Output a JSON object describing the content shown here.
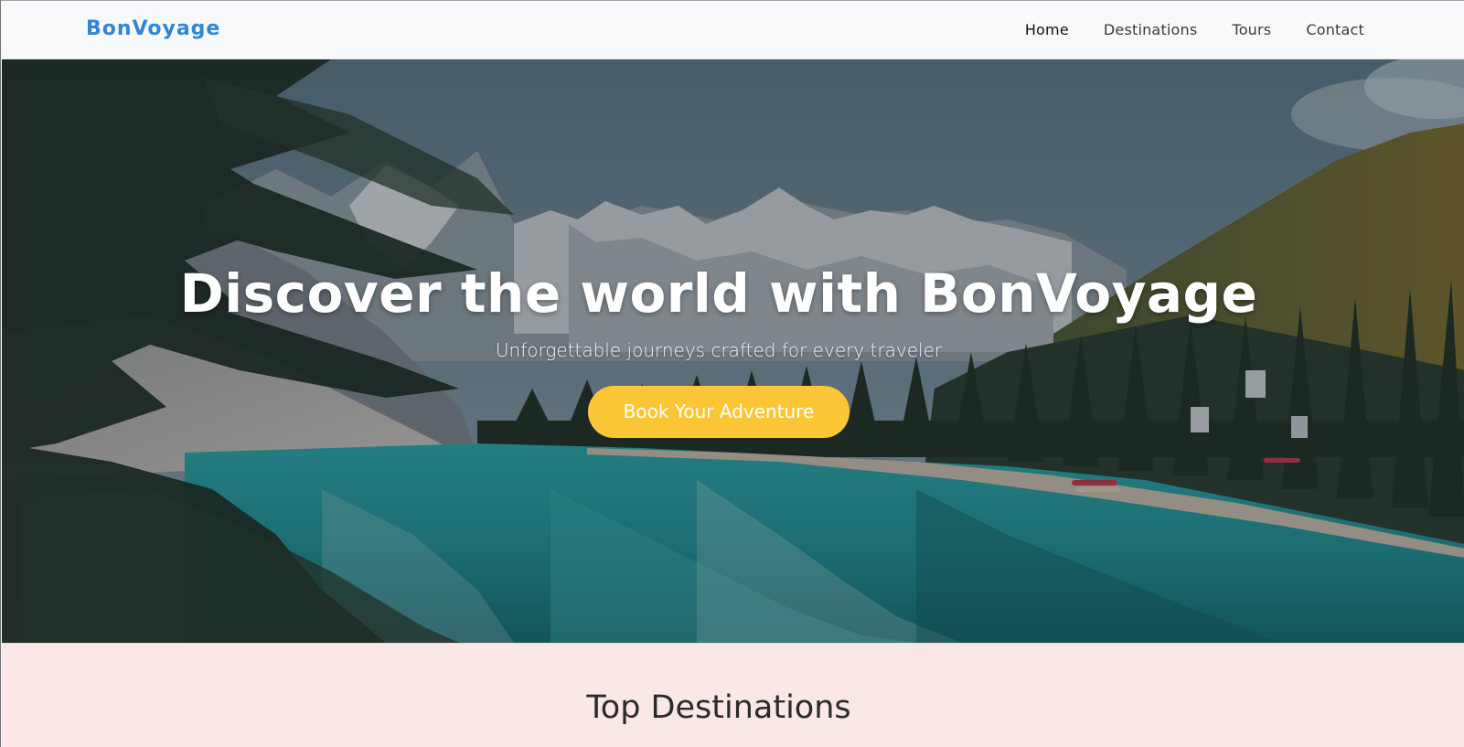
{
  "brand": "BonVoyage",
  "nav": {
    "items": [
      {
        "label": "Home",
        "active": true
      },
      {
        "label": "Destinations",
        "active": false
      },
      {
        "label": "Tours",
        "active": false
      },
      {
        "label": "Contact",
        "active": false
      }
    ]
  },
  "hero": {
    "title": "Discover the world with BonVoyage",
    "subtitle": "Unforgettable journeys crafted for every traveler",
    "cta_label": "Book Your Adventure",
    "cta_color": "#fcc636"
  },
  "destinations": {
    "title": "Top Destinations",
    "background": "#fbe7e6"
  },
  "colors": {
    "brand": "#2f86d6",
    "navbar_bg": "#f8f9fa"
  }
}
